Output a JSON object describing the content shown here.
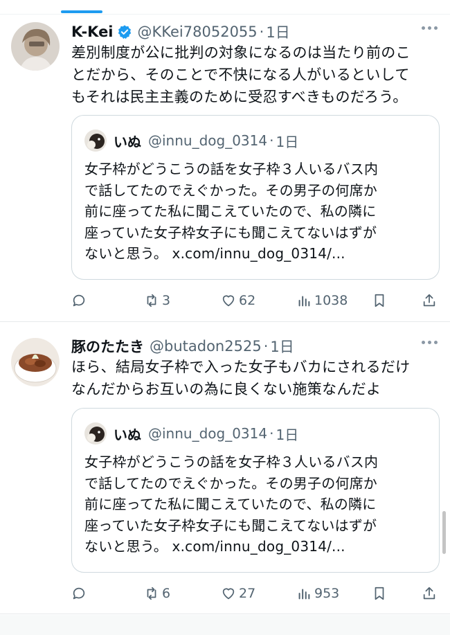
{
  "tweets": [
    {
      "display_name": "K-Kei",
      "verified": true,
      "handle": "@KKei78052055",
      "separator": "·",
      "time": "1日",
      "text_lines": [
        "差別制度が公に批判の対象になるのは当たり前のこ",
        "とだから、そのことで不快になる人がいるといして",
        "もそれは民主主義のために受忍すべきものだろう。"
      ],
      "quote": {
        "display_name": "いぬ",
        "handle": "@innu_dog_0314",
        "separator": "·",
        "time": "1日",
        "text_lines": [
          "女子枠がどうこうの話を女子枠３人いるバス内",
          "で話してたのでえぐかった。その男子の何席か",
          "前に座ってた私に聞こえていたので、私の隣に",
          "座っていた女子枠女子にも聞こえてないはずが",
          "ないと思う。 x.com/innu_dog_0314/..."
        ]
      },
      "actions": {
        "reply_count": "",
        "retweet_count": "3",
        "like_count": "62",
        "views_count": "1038"
      }
    },
    {
      "display_name": "豚のたたき",
      "verified": false,
      "handle": "@butadon2525",
      "separator": "·",
      "time": "1日",
      "text_lines": [
        "ほら、結局女子枠で入った女子もバカにされるだけ",
        "なんだからお互いの為に良くない施策なんだよ"
      ],
      "quote": {
        "display_name": "いぬ",
        "handle": "@innu_dog_0314",
        "separator": "·",
        "time": "1日",
        "text_lines": [
          "女子枠がどうこうの話を女子枠３人いるバス内",
          "で話してたのでえぐかった。その男子の何席か",
          "前に座ってた私に聞こえていたので、私の隣に",
          "座っていた女子枠女子にも聞こえてないはずが",
          "ないと思う。 x.com/innu_dog_0314/..."
        ]
      },
      "actions": {
        "reply_count": "",
        "retweet_count": "6",
        "like_count": "27",
        "views_count": "953"
      }
    }
  ],
  "icons": {
    "verified": "verified-badge-icon",
    "more": "more-dots-icon",
    "reply": "reply-icon",
    "retweet": "retweet-icon",
    "like": "heart-icon",
    "views": "views-bar-chart-icon",
    "bookmark": "bookmark-icon",
    "share": "share-icon"
  },
  "colors": {
    "accent": "#1d9bf0",
    "text": "#0f1419",
    "secondary": "#536471",
    "border": "#cfd9de"
  }
}
